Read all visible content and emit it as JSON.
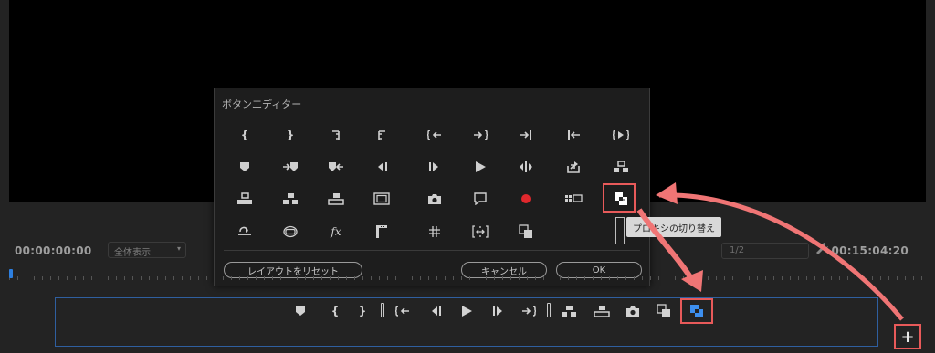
{
  "monitor": {
    "timecode_left": "00:00:00:00",
    "fit_label": "全体表示",
    "resolution": "1/2",
    "timecode_right": "00:15:04:20"
  },
  "dialog": {
    "title": "ボタンエディター",
    "reset_label": "レイアウトをリセット",
    "cancel_label": "キャンセル",
    "ok_label": "OK"
  },
  "tooltip": "プロキシの切り替え",
  "icons": {
    "row1": [
      "mark-in-icon",
      "mark-out-icon",
      "clear-in-icon",
      "clear-out-icon",
      "go-to-in-icon",
      "go-to-out-icon",
      "step-back-edit-icon",
      "step-forward-edit-icon",
      "play-in-to-out-icon"
    ],
    "row2": [
      "add-marker-icon",
      "go-to-next-marker-icon",
      "go-to-prev-marker-icon",
      "step-back-icon",
      "step-forward-icon",
      "play-icon",
      "play-around-icon",
      "export-icon",
      "lift-icon"
    ],
    "row3": [
      "extract-icon",
      "insert-icon",
      "overwrite-icon",
      "safe-margins-icon",
      "camera-icon",
      "comment-icon",
      "record-icon",
      "multi-camera-icon",
      "toggle-proxy-icon"
    ],
    "row4": [
      "loop-icon",
      "vr-video-icon",
      "fx-icon",
      "frame-ruler-icon",
      "hash-icon",
      "trim-icon",
      "compare-view-icon"
    ]
  },
  "fx_glyph": "fx",
  "plus_glyph": "+",
  "colors": {
    "accent_red": "#e85a5a",
    "accent_blue": "#2d7fe0",
    "record_red": "#e0282d"
  }
}
